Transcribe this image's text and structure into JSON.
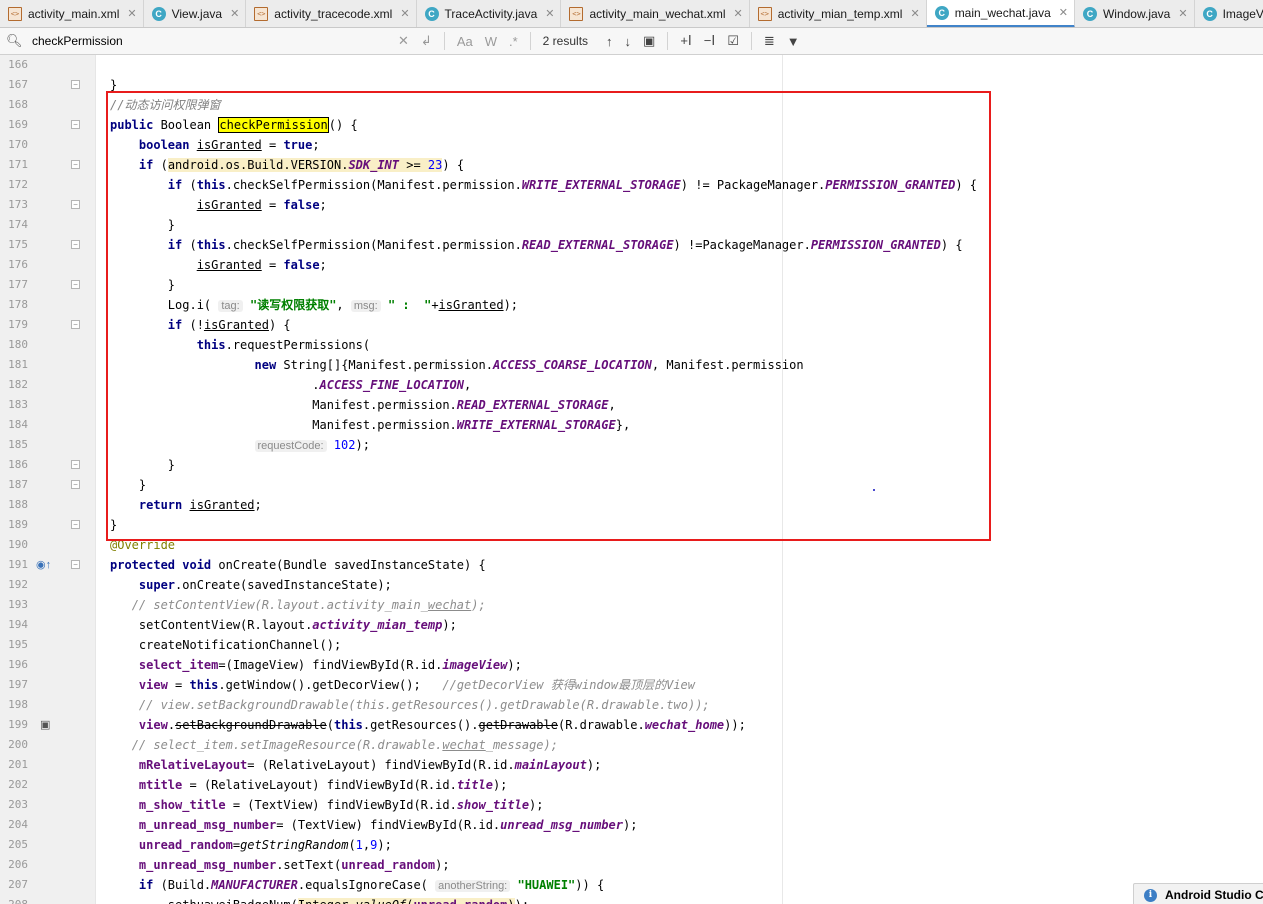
{
  "tabs": [
    {
      "label": "activity_main.xml",
      "type": "xml",
      "active": false
    },
    {
      "label": "View.java",
      "type": "java",
      "active": false
    },
    {
      "label": "activity_tracecode.xml",
      "type": "xml",
      "active": false
    },
    {
      "label": "TraceActivity.java",
      "type": "java",
      "active": false
    },
    {
      "label": "activity_main_wechat.xml",
      "type": "xml",
      "active": false
    },
    {
      "label": "activity_mian_temp.xml",
      "type": "xml",
      "active": false
    },
    {
      "label": "main_wechat.java",
      "type": "java",
      "active": true
    },
    {
      "label": "Window.java",
      "type": "java",
      "active": false
    },
    {
      "label": "ImageView",
      "type": "java",
      "active": false
    }
  ],
  "search": {
    "value": "checkPermission",
    "results": "2 results",
    "match_case_label": "Aa",
    "words_label": "W",
    "regex_label": ".*"
  },
  "line_numbers": [
    "166",
    "167",
    "168",
    "169",
    "170",
    "171",
    "172",
    "173",
    "174",
    "175",
    "176",
    "177",
    "178",
    "179",
    "180",
    "181",
    "182",
    "183",
    "184",
    "185",
    "186",
    "187",
    "188",
    "189",
    "190",
    "191",
    "192",
    "193",
    "194",
    "195",
    "196",
    "197",
    "198",
    "199",
    "200",
    "201",
    "202",
    "203",
    "204",
    "205",
    "206",
    "207",
    "208"
  ],
  "hints": {
    "tag": "tag:",
    "msg": "msg:",
    "requestCode": "requestCode:",
    "anotherString": "anotherString:"
  },
  "code": {
    "l168_comment": "//动态访问权限弹窗",
    "l169_method": "checkPermission",
    "l178_string": "\"读写权限获取\"",
    "l178_string2": "\" :  \"",
    "l197_comment": "//getDecorView 获得window最顶层的View",
    "l207_string": "\"HUAWEI\""
  },
  "notification": {
    "label": "Android Studio Ch"
  }
}
